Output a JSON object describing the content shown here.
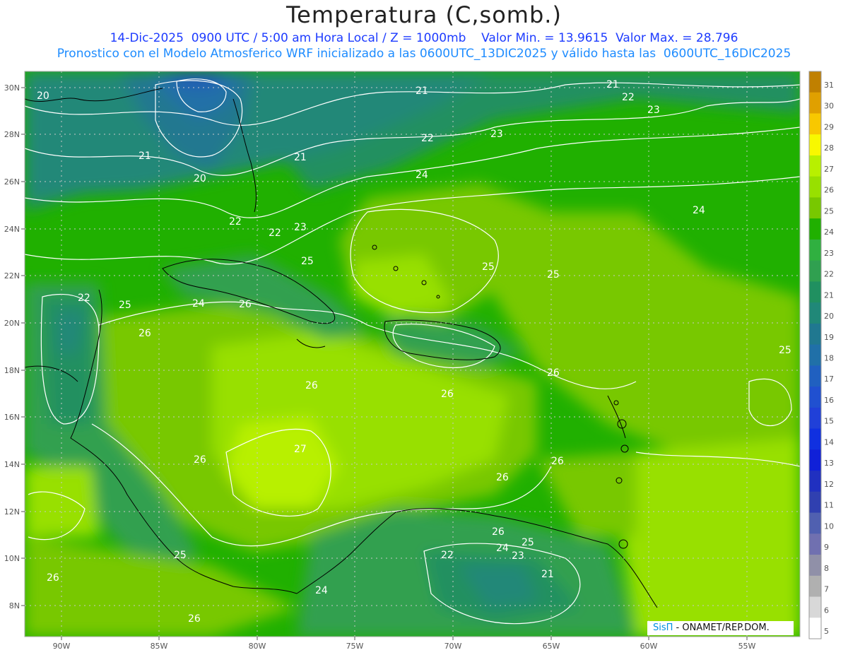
{
  "title": "Temperatura (C,somb.)",
  "subtitle_line1": "14-Dic-2025  0900 UTC / 5:00 am Hora Local / Z = 1000mb    Valor Min. = 13.9615  Valor Max. = 28.796",
  "subtitle_line2": "Pronostico con el Modelo Atmosferico WRF inicializado a las 0600UTC_13DIC2025 y válido hasta las  0600UTC_16DIC2025",
  "lat_labels": [
    "30N",
    "28N",
    "26N",
    "24N",
    "22N",
    "20N",
    "18N",
    "16N",
    "14N",
    "12N",
    "10N",
    "8N"
  ],
  "lon_labels": [
    "90W",
    "85W",
    "80W",
    "75W",
    "70W",
    "65W",
    "60W",
    "55W"
  ],
  "colorbar_labels": [
    "31",
    "30",
    "29",
    "28",
    "27",
    "26",
    "25",
    "24",
    "23",
    "22",
    "21",
    "20",
    "19",
    "18",
    "17",
    "16",
    "15",
    "14",
    "13",
    "12",
    "11",
    "10",
    "9",
    "8",
    "7",
    "6",
    "5"
  ],
  "colorbar_colors": [
    "#c08000",
    "#e0a000",
    "#f8c800",
    "#f8f800",
    "#b8f000",
    "#98e000",
    "#78c800",
    "#20b000",
    "#30b040",
    "#30a050",
    "#209060",
    "#208878",
    "#207890",
    "#2070a8",
    "#2060c0",
    "#2050d0",
    "#2040d8",
    "#1030e0",
    "#1020d8",
    "#2030c0",
    "#3040b0",
    "#5060b0",
    "#7070b0",
    "#9090a8",
    "#b0b0b0",
    "#d8d8d8",
    "#ffffff"
  ],
  "contour_labels": [
    "21",
    "21",
    "22",
    "22",
    "23",
    "23",
    "24",
    "24",
    "25",
    "25",
    "25",
    "25",
    "26",
    "26",
    "26",
    "26",
    "26",
    "26",
    "27",
    "20",
    "20",
    "21",
    "21",
    "22",
    "22",
    "22",
    "23",
    "22",
    "24",
    "25",
    "25",
    "26",
    "26",
    "24",
    "26",
    "26",
    "25",
    "24",
    "23",
    "21",
    "26",
    "25"
  ],
  "logo": {
    "sis": "SisΠ",
    "text": " - ONAMET/REP.DOM."
  }
}
